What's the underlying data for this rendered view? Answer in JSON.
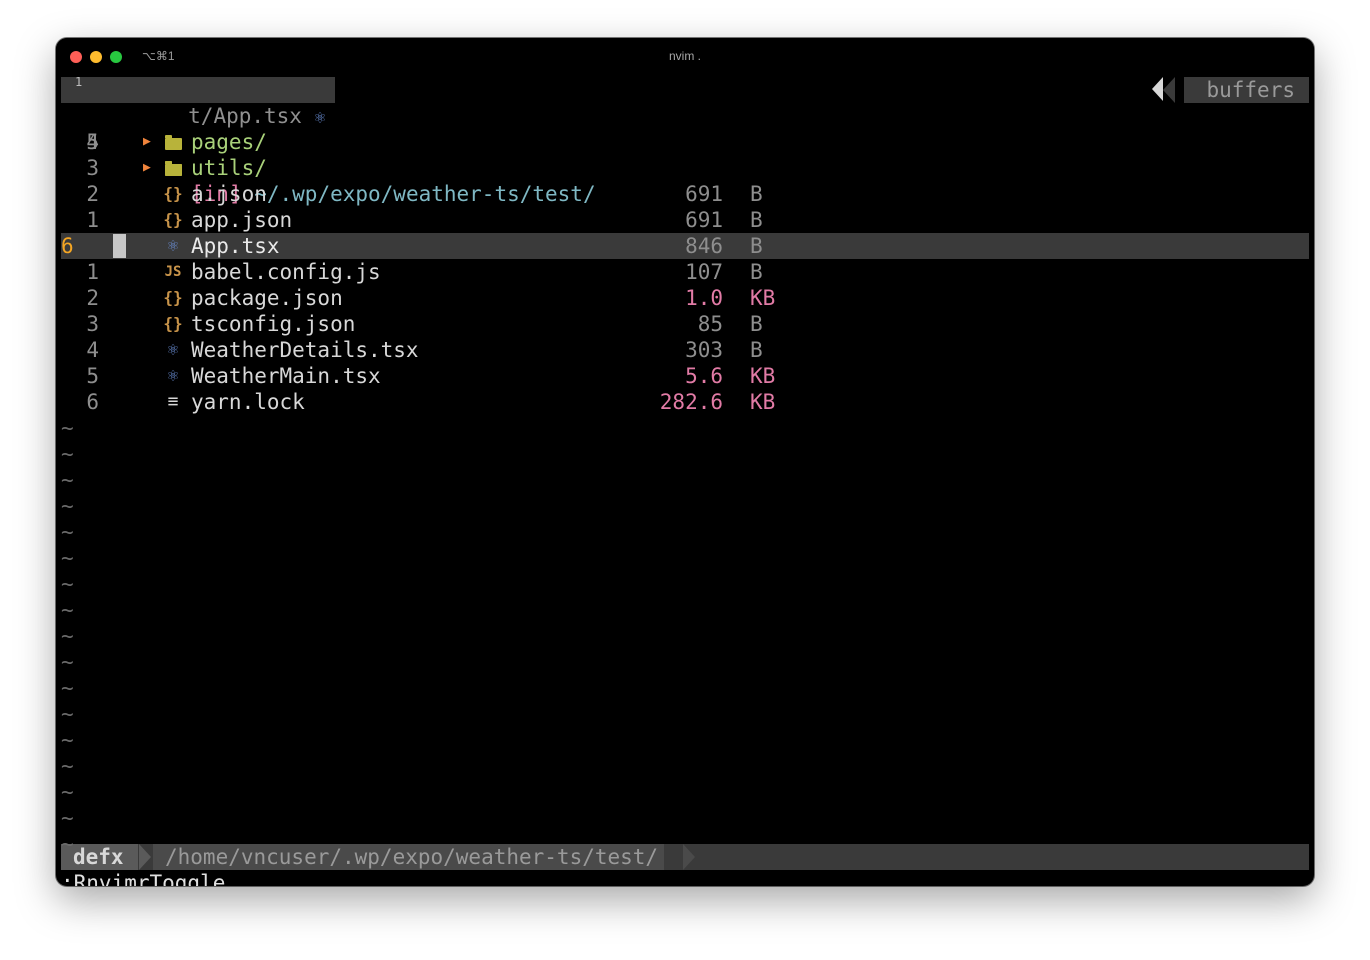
{
  "window": {
    "shortcut": "⌥⌘1",
    "title": "nvim ."
  },
  "tabline": {
    "tab_number": "1",
    "tab_label": "t/App.tsx",
    "right_label": "buffers"
  },
  "header_row": {
    "line_number": "5",
    "tag": "[in]",
    "path": "~/.wp/expo/weather-ts/test/"
  },
  "folders": [
    {
      "line_number": "4",
      "name": "pages/"
    },
    {
      "line_number": "3",
      "name": "utils/"
    }
  ],
  "files": [
    {
      "line_number": "2",
      "icon": "json-icon",
      "icon_glyph": "{}",
      "name": "a.json",
      "size": "691",
      "unit": "B",
      "highlight": false
    },
    {
      "line_number": "1",
      "icon": "json-icon",
      "icon_glyph": "{}",
      "name": "app.json",
      "size": "691",
      "unit": "B",
      "highlight": false
    },
    {
      "line_number": "6",
      "icon": "react-icon",
      "icon_glyph": "⚛",
      "name": "App.tsx",
      "size": "846",
      "unit": "B",
      "highlight": false,
      "current": true
    },
    {
      "line_number": "1",
      "icon": "js-icon",
      "icon_glyph": "JS",
      "name": "babel.config.js",
      "size": "107",
      "unit": "B",
      "highlight": false
    },
    {
      "line_number": "2",
      "icon": "json-icon",
      "icon_glyph": "{}",
      "name": "package.json",
      "size": "1.0",
      "unit": "KB",
      "highlight": true
    },
    {
      "line_number": "3",
      "icon": "json-icon",
      "icon_glyph": "{}",
      "name": "tsconfig.json",
      "size": "85",
      "unit": "B",
      "highlight": false
    },
    {
      "line_number": "4",
      "icon": "react-icon",
      "icon_glyph": "⚛",
      "name": "WeatherDetails.tsx",
      "size": "303",
      "unit": "B",
      "highlight": false
    },
    {
      "line_number": "5",
      "icon": "react-icon",
      "icon_glyph": "⚛",
      "name": "WeatherMain.tsx",
      "size": "5.6",
      "unit": "KB",
      "highlight": true
    },
    {
      "line_number": "6",
      "icon": "lines-icon",
      "icon_glyph": "≡",
      "name": "yarn.lock",
      "size": "282.6",
      "unit": "KB",
      "highlight": true
    }
  ],
  "tilde_char": "~",
  "statusline": {
    "mode": "defx",
    "path": "/home/vncuser/.wp/expo/weather-ts/test/"
  },
  "command_line": ":RnvimrToggle",
  "colors": {
    "accent_pink": "#e27ba6",
    "folder_green": "#a9d17a",
    "current_line_number": "#f5a623"
  }
}
